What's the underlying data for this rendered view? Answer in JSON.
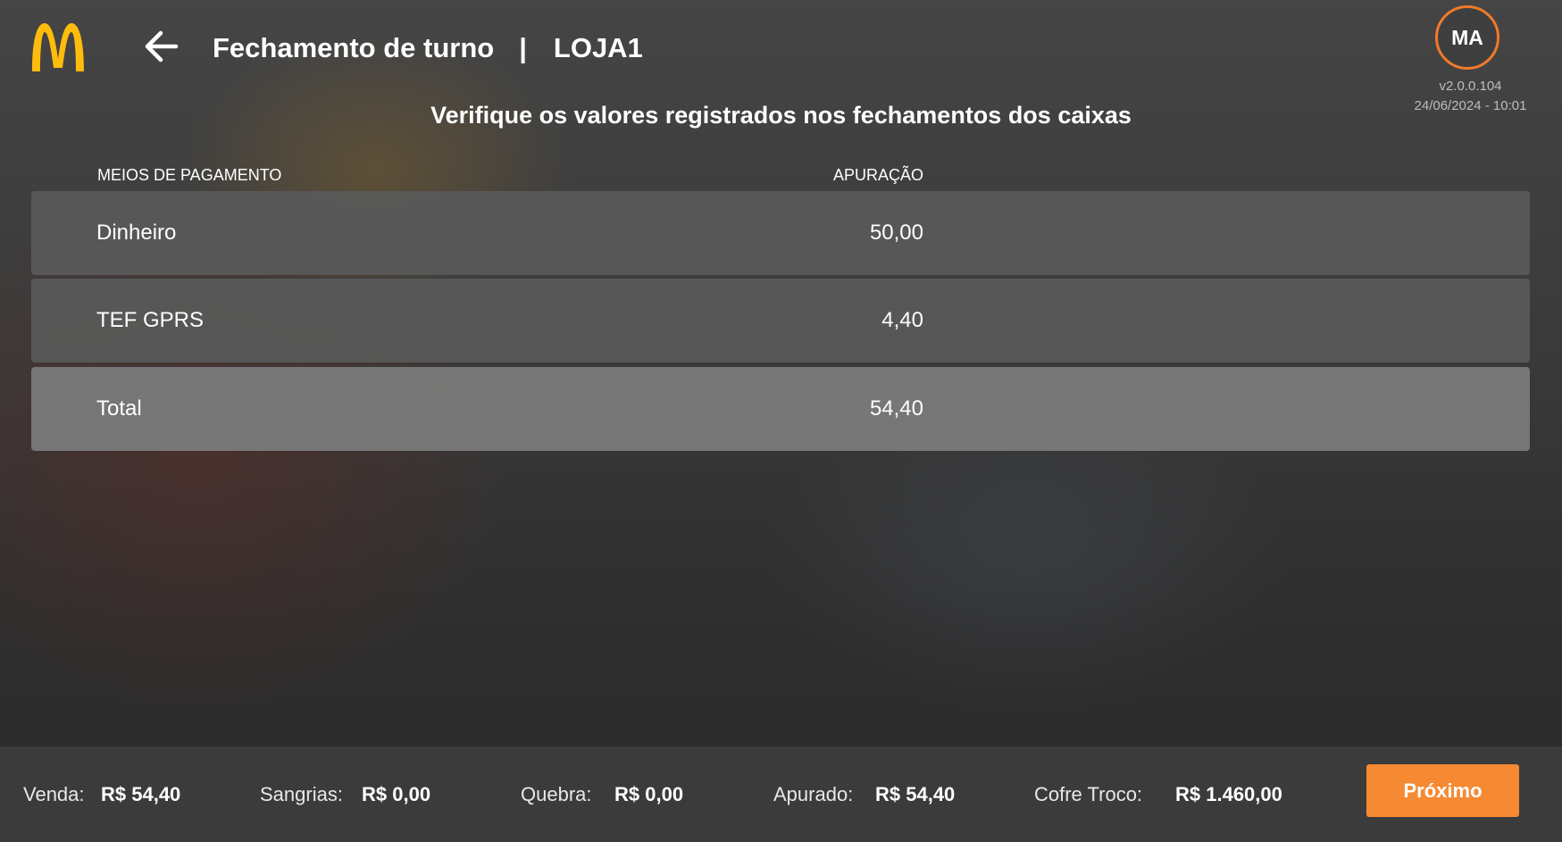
{
  "header": {
    "title": "Fechamento de turno",
    "separator": "|",
    "store": "LOJA1",
    "back_icon": "arrow-left-icon",
    "logo": "mcdonalds-arches-logo"
  },
  "user": {
    "initials": "MA",
    "version": "v2.0.0.104",
    "datetime": "24/06/2024 - 10:01"
  },
  "subtitle": "Verifique os valores registrados nos fechamentos dos caixas",
  "table": {
    "headers": {
      "method": "MEIOS DE PAGAMENTO",
      "amount": "APURAÇÃO"
    },
    "rows": [
      {
        "method": "Dinheiro",
        "amount": "50,00"
      },
      {
        "method": "TEF GPRS",
        "amount": "4,40"
      }
    ],
    "total": {
      "label": "Total",
      "amount": "54,40"
    }
  },
  "footer": {
    "venda_label": "Venda:",
    "venda_value": "R$ 54,40",
    "sangrias_label": "Sangrias:",
    "sangrias_value": "R$ 0,00",
    "quebra_label": "Quebra:",
    "quebra_value": "R$ 0,00",
    "apurado_label": "Apurado:",
    "apurado_value": "R$ 54,40",
    "cofre_label": "Cofre Troco:",
    "cofre_value": "R$ 1.460,00",
    "next_button": "Próximo"
  },
  "colors": {
    "accent": "#f58a33",
    "logo_yellow": "#ffbc0d",
    "avatar_ring": "#f07a2a"
  }
}
